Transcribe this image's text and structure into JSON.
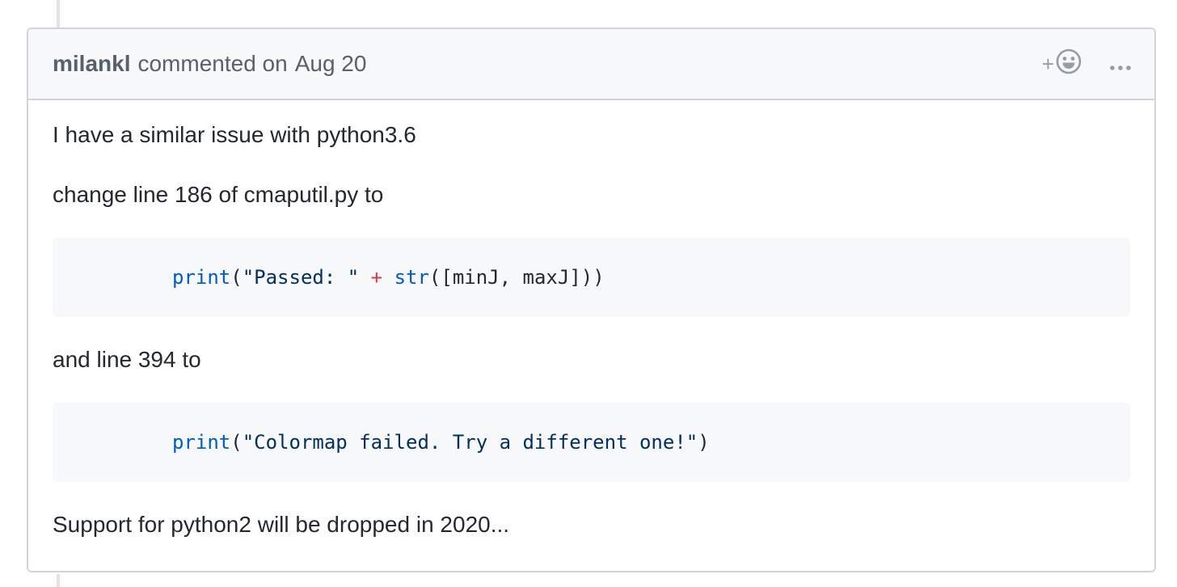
{
  "comment": {
    "author": "milankl",
    "action": "commented on",
    "date": "Aug 20",
    "add_reaction_label": "+",
    "icons": {
      "reaction": "smiley-icon",
      "more": "kebab-horizontal-icon"
    },
    "body": {
      "para1": "I have a similar issue with python3.6",
      "para2": "change line 186 of cmaputil.py to",
      "code1": {
        "fn": "print",
        "open": "(",
        "str": "\"Passed: \"",
        "op": " + ",
        "fn2": "str",
        "rest": "([minJ, maxJ]))"
      },
      "para3": "and line 394 to",
      "code2": {
        "fn": "print",
        "open": "(",
        "str": "\"Colormap failed. Try a different one!\"",
        "close": ")"
      },
      "para4": "Support for python2 will be dropped in 2020..."
    }
  },
  "colors": {
    "header_bg": "#f6f8fa",
    "border": "#d1d5da",
    "code_bg": "#f6f8fa",
    "syntax_function": "#005cc5",
    "syntax_string": "#032f62",
    "syntax_operator": "#d73a49"
  }
}
